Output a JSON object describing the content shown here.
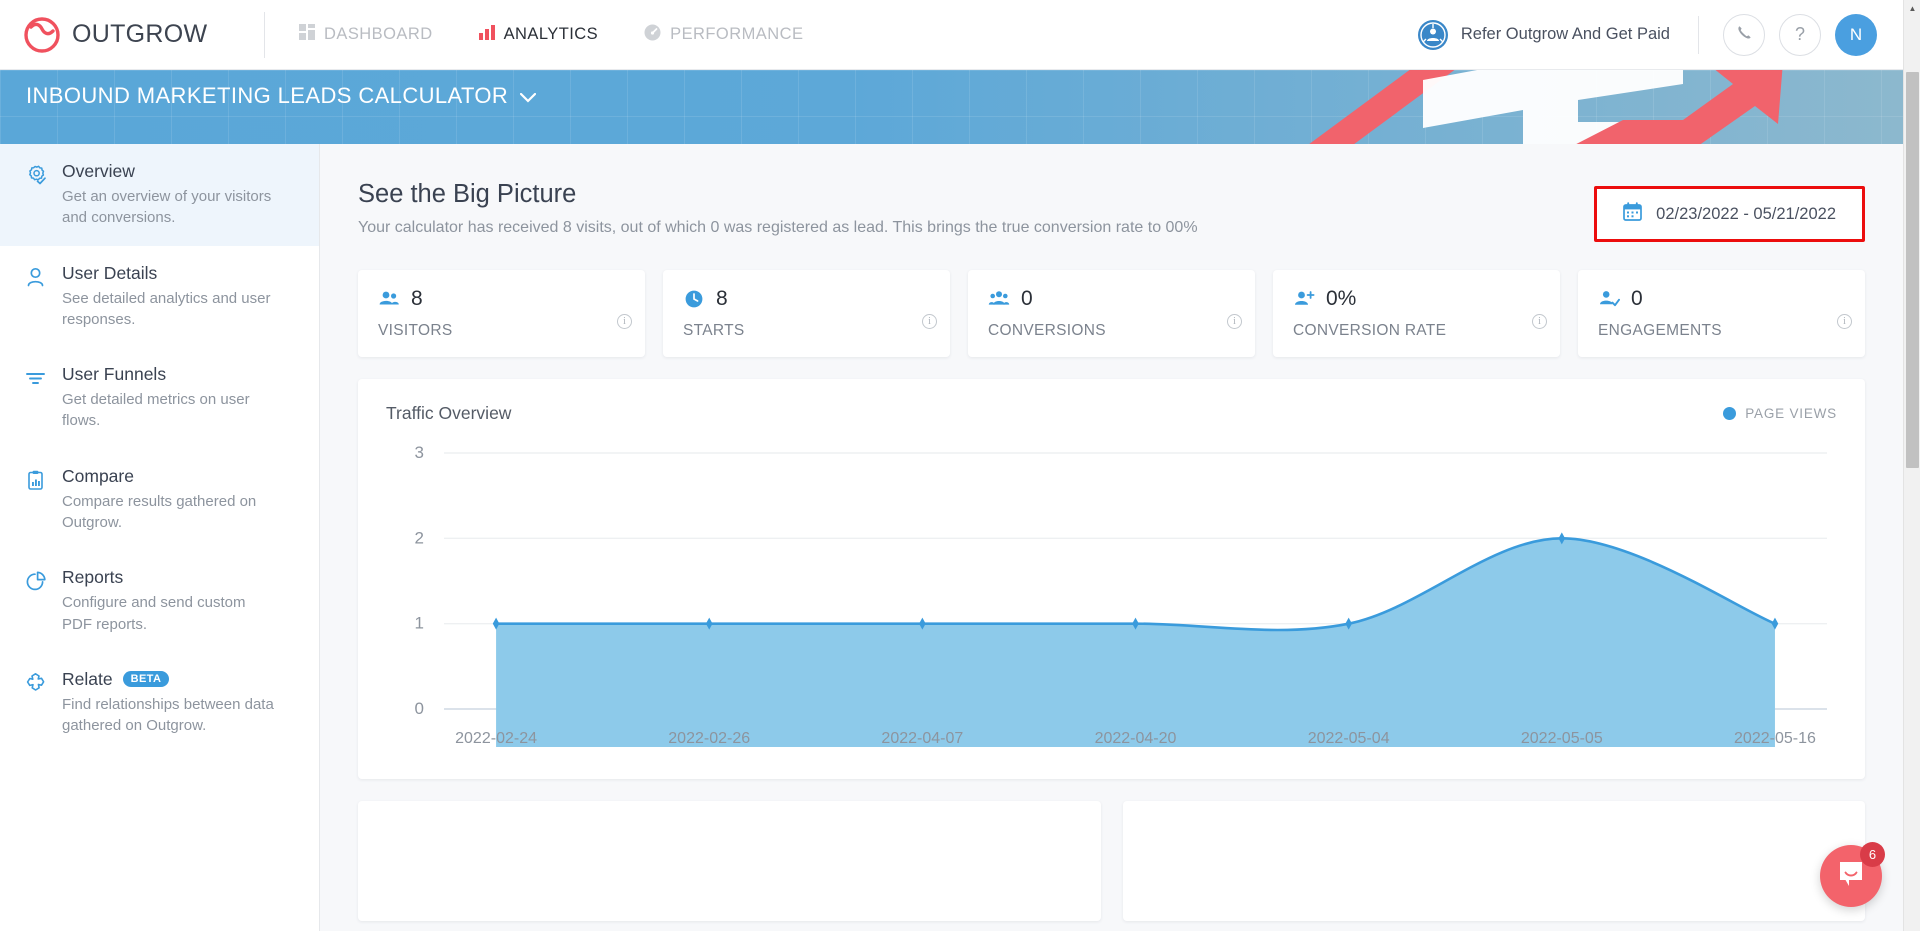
{
  "topnav": {
    "brand": "OUTGROW",
    "brand_icon": "outgrow-logo-icon",
    "tabs": [
      {
        "label": "DASHBOARD",
        "icon": "grid-icon",
        "active": false
      },
      {
        "label": "ANALYTICS",
        "icon": "bar-chart-icon",
        "active": true
      },
      {
        "label": "PERFORMANCE",
        "icon": "speedometer-icon",
        "active": false
      }
    ],
    "refer_label": "Refer Outgrow And Get Paid",
    "refer_icon": "referral-user-icon",
    "phone_icon": "phone-icon",
    "help_icon": "question-mark-icon",
    "avatar_initial": "N"
  },
  "banner": {
    "title": "INBOUND MARKETING LEADS CALCULATOR",
    "chevron_icon": "chevron-down-icon"
  },
  "sidebar": {
    "items": [
      {
        "label": "Overview",
        "desc": "Get an overview of your visitors and conversions.",
        "icon": "gear-check-icon",
        "active": true,
        "badge": ""
      },
      {
        "label": "User Details",
        "desc": "See detailed analytics and user responses.",
        "icon": "person-icon",
        "active": false,
        "badge": ""
      },
      {
        "label": "User Funnels",
        "desc": "Get detailed metrics on user flows.",
        "icon": "funnel-icon",
        "active": false,
        "badge": ""
      },
      {
        "label": "Compare",
        "desc": "Compare results gathered on Outgrow.",
        "icon": "clipboard-chart-icon",
        "active": false,
        "badge": ""
      },
      {
        "label": "Reports",
        "desc": "Configure and send custom PDF reports.",
        "icon": "pie-chart-icon",
        "active": false,
        "badge": ""
      },
      {
        "label": "Relate",
        "desc": "Find relationships between data gathered on Outgrow.",
        "icon": "puzzle-icon",
        "active": false,
        "badge": "BETA"
      }
    ]
  },
  "main": {
    "title": "See the Big Picture",
    "subtitle": "Your calculator has received 8 visits, out of which 0 was registered as lead. This brings the true conversion rate to 00%",
    "daterange": {
      "value": "02/23/2022 - 05/21/2022",
      "icon": "calendar-icon",
      "highlight_color": "#ec0d0d"
    },
    "stats": [
      {
        "value": "8",
        "label": "VISITORS",
        "icon": "people-icon",
        "info_icon": "info-icon"
      },
      {
        "value": "8",
        "label": "STARTS",
        "icon": "clock-icon",
        "info_icon": "info-icon"
      },
      {
        "value": "0",
        "label": "CONVERSIONS",
        "icon": "people-group-icon",
        "info_icon": "info-icon"
      },
      {
        "value": "0%",
        "label": "CONVERSION RATE",
        "icon": "person-plus-icon",
        "info_icon": "info-icon"
      },
      {
        "value": "0",
        "label": "ENGAGEMENTS",
        "icon": "person-check-icon",
        "info_icon": "info-icon"
      }
    ]
  },
  "chart_data": {
    "type": "area",
    "title": "Traffic Overview",
    "legend": [
      {
        "name": "PAGE VIEWS",
        "color": "#3a9bdc"
      }
    ],
    "legend_position": "top-right",
    "x": [
      "2022-02-24",
      "2022-02-26",
      "2022-04-07",
      "2022-04-20",
      "2022-05-04",
      "2022-05-05",
      "2022-05-16"
    ],
    "series": [
      {
        "name": "PAGE VIEWS",
        "values": [
          1,
          1,
          1,
          1,
          1,
          2,
          1
        ]
      }
    ],
    "xlabel": "",
    "ylabel": "",
    "yticks": [
      0,
      1,
      2,
      3
    ],
    "ylim": [
      0,
      3
    ],
    "grid": true,
    "fill_color": "#8dcaea",
    "line_color": "#3a9bdc"
  },
  "chat": {
    "badge": "6",
    "icon": "chat-bubble-icon"
  },
  "scrollbar": {
    "up_arrow_icon": "triangle-up-icon",
    "down_arrow_icon": "triangle-down-icon"
  }
}
